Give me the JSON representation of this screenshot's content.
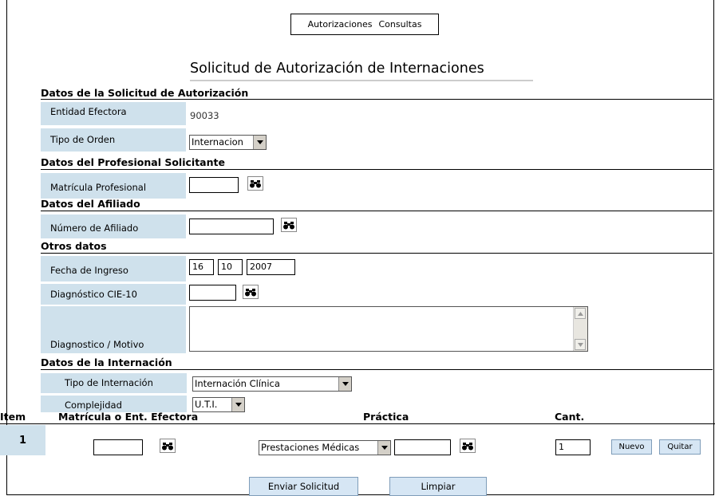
{
  "menu": {
    "items": [
      "Autorizaciones",
      "Consultas"
    ]
  },
  "page_title": "Solicitud de Autorización de Internaciones",
  "sections": {
    "solicitud": "Datos de la Solicitud de Autorización",
    "profesional": "Datos del Profesional Solicitante",
    "afiliado": "Datos del Afiliado",
    "otros": "Otros datos",
    "internacion": "Datos de la Internación"
  },
  "fields": {
    "entidad_label": "Entidad Efectora",
    "entidad_value": "90033",
    "tipo_orden_label": "Tipo de Orden",
    "tipo_orden_value": "Internacion",
    "matricula_label": "Matrícula Profesional",
    "matricula_value": "",
    "afiliado_label": "Número de Afiliado",
    "afiliado_value": "",
    "fecha_label": "Fecha de Ingreso",
    "fecha_day": "16",
    "fecha_month": "10",
    "fecha_year": "2007",
    "diag_cie_label": "Diagnóstico CIE-10",
    "diag_cie_value": "",
    "diag_motivo_label": "Diagnostico / Motivo",
    "diag_motivo_value": "",
    "tipo_internacion_label": "Tipo de Internación",
    "tipo_internacion_value": "Internación Clínica",
    "complejidad_label": "Complejidad",
    "complejidad_value": "U.T.I."
  },
  "table": {
    "headers": [
      "Item",
      "Matrícula o Ent. Efectora",
      "Práctica",
      "Cant."
    ],
    "rows": [
      {
        "item": "1",
        "matricula": "",
        "practica_tipo": "Prestaciones Médicas",
        "practica_codigo": "",
        "cantidad": "1",
        "nuevo": "Nuevo",
        "quitar": "Quitar"
      }
    ]
  },
  "actions": {
    "enviar": "Enviar Solicitud",
    "limpiar": "Limpiar"
  },
  "icons": {
    "search": "binoculars-icon",
    "dropdown": "chevron-down-icon"
  },
  "colors": {
    "label_bg": "#cfe1ec",
    "button_bg": "#d6e6f4"
  }
}
